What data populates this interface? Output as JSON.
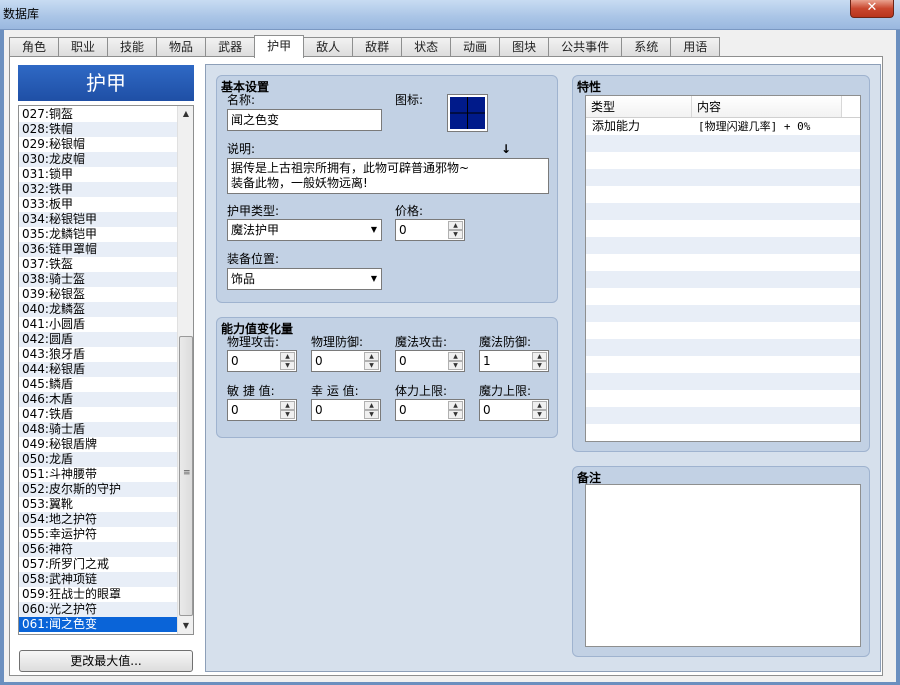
{
  "window": {
    "title": "数据库",
    "close_glyph": "✕"
  },
  "tabs": [
    {
      "label": "角色"
    },
    {
      "label": "职业"
    },
    {
      "label": "技能"
    },
    {
      "label": "物品"
    },
    {
      "label": "武器"
    },
    {
      "label": "护甲"
    },
    {
      "label": "敌人"
    },
    {
      "label": "敌群"
    },
    {
      "label": "状态"
    },
    {
      "label": "动画"
    },
    {
      "label": "图块"
    },
    {
      "label": "公共事件"
    },
    {
      "label": "系统"
    },
    {
      "label": "用语"
    }
  ],
  "active_tab": "护甲",
  "list": {
    "header": "护甲",
    "items": [
      "027:铜盔",
      "028:铁帽",
      "029:秘银帽",
      "030:龙皮帽",
      "031:锁甲",
      "032:铁甲",
      "033:板甲",
      "034:秘银铠甲",
      "035:龙鳞铠甲",
      "036:链甲罩帽",
      "037:铁盔",
      "038:骑士盔",
      "039:秘银盔",
      "040:龙鳞盔",
      "041:小圆盾",
      "042:圆盾",
      "043:狼牙盾",
      "044:秘银盾",
      "045:鳞盾",
      "046:木盾",
      "047:铁盾",
      "048:骑士盾",
      "049:秘银盾牌",
      "050:龙盾",
      "051:斗神腰带",
      "052:皮尔斯的守护",
      "053:翼靴",
      "054:地之护符",
      "055:幸运护符",
      "056:神符",
      "057:所罗门之戒",
      "058:武神项链",
      "059:狂战士的眼罩",
      "060:光之护符",
      "061:闻之色变"
    ],
    "selected_index": 34,
    "change_max_label": "更改最大值..."
  },
  "basic": {
    "header": "基本设置",
    "name_label": "名称:",
    "name_value": "闻之色变",
    "icon_label": "图标:",
    "desc_label": "说明:",
    "desc_line1": "据传是上古祖宗所拥有，此物可辟普通邪物~",
    "desc_line2": "装备此物，一般妖物远离!",
    "armor_type_label": "护甲类型:",
    "armor_type_value": "魔法护甲",
    "price_label": "价格:",
    "price_value": "0",
    "equip_slot_label": "装备位置:",
    "equip_slot_value": "饰品"
  },
  "params": {
    "header": "能力值变化量",
    "fields": [
      {
        "label": "物理攻击:",
        "value": "0"
      },
      {
        "label": "物理防御:",
        "value": "0"
      },
      {
        "label": "魔法攻击:",
        "value": "0"
      },
      {
        "label": "魔法防御:",
        "value": "1"
      },
      {
        "label": "敏 捷 值:",
        "value": "0"
      },
      {
        "label": "幸 运 值:",
        "value": "0"
      },
      {
        "label": "体力上限:",
        "value": "0"
      },
      {
        "label": "魔力上限:",
        "value": "0"
      }
    ]
  },
  "traits": {
    "header": "特性",
    "col_type": "类型",
    "col_content": "内容",
    "rows": [
      {
        "type": "添加能力",
        "content": "[物理闪避几率] + 0%"
      }
    ]
  },
  "notes": {
    "header": "备注",
    "text": ""
  },
  "colors": {
    "selection": "#0a64d8",
    "header_blue": "#1f4fa5",
    "group_bg": "#c2d1e4"
  }
}
